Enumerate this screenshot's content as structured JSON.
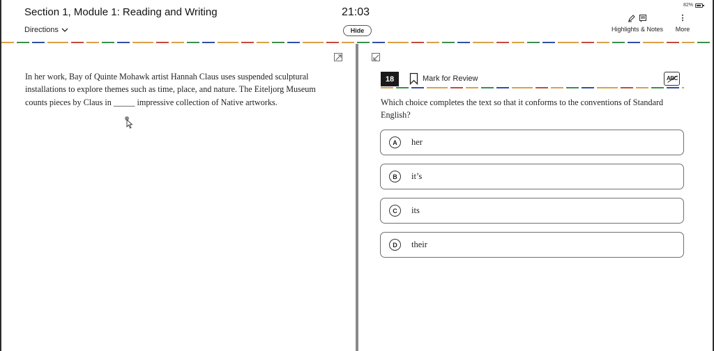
{
  "header": {
    "section_title": "Section 1, Module 1: Reading and Writing",
    "directions_label": "Directions",
    "timer": "21:03",
    "hide_label": "Hide",
    "battery_percent": "82%",
    "battery_level": 0.82,
    "highlights_label": "Highlights & Notes",
    "more_label": "More"
  },
  "passage": {
    "text": "In her work, Bay of Quinte Mohawk artist Hannah Claus uses suspended sculptural installations to explore themes such as time, place, and nature. The Eiteljorg Museum counts pieces by Claus in _____ impressive collection of Native artworks."
  },
  "question": {
    "number": "18",
    "mark_review_label": "Mark for Review",
    "abc_label": "ABC",
    "prompt": "Which choice completes the text so that it conforms to the conventions of Standard English?",
    "choices": [
      {
        "letter": "A",
        "text": "her"
      },
      {
        "letter": "B",
        "text": "it’s"
      },
      {
        "letter": "C",
        "text": "its"
      },
      {
        "letter": "D",
        "text": "their"
      }
    ]
  },
  "icons": {
    "pencil": "pencil-icon",
    "notes": "notes-icon",
    "more": "more-vertical-icon",
    "chevron": "chevron-down-icon",
    "expand": "expand-icon",
    "collapse": "collapse-icon",
    "bookmark": "bookmark-icon",
    "battery": "battery-icon",
    "cursor": "cursor-icon"
  },
  "colors": {
    "stripe_orange": "#d9a046",
    "stripe_green": "#3a8e4c",
    "stripe_blue": "#2f4fa6",
    "stripe_red": "#c24a3a"
  }
}
